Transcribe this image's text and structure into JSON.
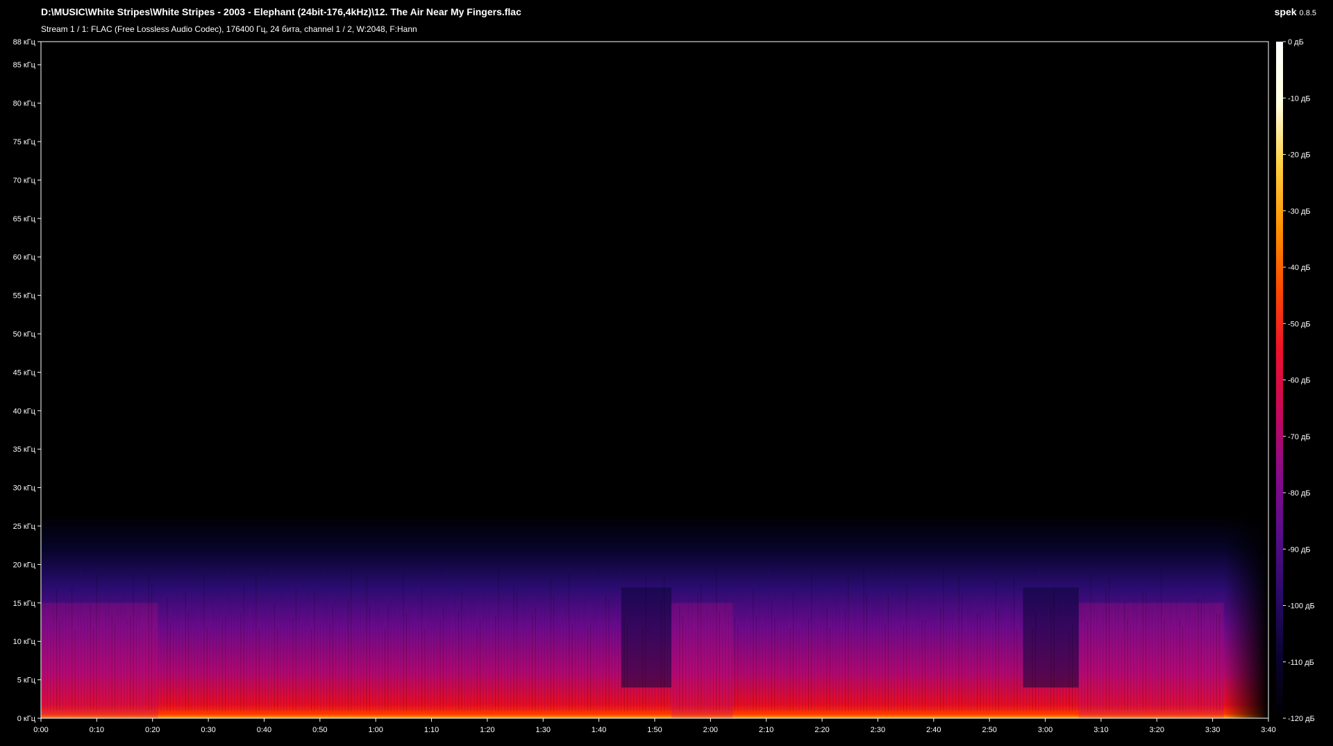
{
  "header": {
    "file_path": "D:\\MUSIC\\White Stripes\\White Stripes - 2003 - Elephant (24bit-176,4kHz)\\12. The Air Near My Fingers.flac",
    "stream_info": "Stream 1 / 1: FLAC (Free Lossless Audio Codec), 176400 Гц, 24 бита, channel 1 / 2, W:2048, F:Hann"
  },
  "app": {
    "name": "spek",
    "version": "0.8.5"
  },
  "frequency_axis": {
    "labels": [
      "0 кГц",
      "5 кГц",
      "10 кГц",
      "15 кГц",
      "20 кГц",
      "25 кГц",
      "30 кГц",
      "35 кГц",
      "40 кГц",
      "45 кГц",
      "50 кГц",
      "55 кГц",
      "60 кГц",
      "65 кГц",
      "70 кГц",
      "75 кГц",
      "80 кГц",
      "85 кГц",
      "88 кГц"
    ],
    "values_khz": [
      0,
      5,
      10,
      15,
      20,
      25,
      30,
      35,
      40,
      45,
      50,
      55,
      60,
      65,
      70,
      75,
      80,
      85,
      88
    ],
    "max_khz": 88
  },
  "time_axis": {
    "labels": [
      "0:00",
      "0:10",
      "0:20",
      "0:30",
      "0:40",
      "0:50",
      "1:00",
      "1:10",
      "1:20",
      "1:30",
      "1:40",
      "1:50",
      "2:00",
      "2:10",
      "2:20",
      "2:30",
      "2:40",
      "2:50",
      "3:00",
      "3:10",
      "3:20",
      "3:30",
      "3:40"
    ],
    "values_s": [
      0,
      10,
      20,
      30,
      40,
      50,
      60,
      70,
      80,
      90,
      100,
      110,
      120,
      130,
      140,
      150,
      160,
      170,
      180,
      190,
      200,
      210,
      220
    ],
    "max_s": 220
  },
  "level_scale": {
    "labels": [
      "0 дБ",
      "-10 дБ",
      "-20 дБ",
      "-30 дБ",
      "-40 дБ",
      "-50 дБ",
      "-60 дБ",
      "-70 дБ",
      "-80 дБ",
      "-90 дБ",
      "-100 дБ",
      "-110 дБ",
      "-120 дБ"
    ],
    "values_db": [
      0,
      -10,
      -20,
      -30,
      -40,
      -50,
      -60,
      -70,
      -80,
      -90,
      -100,
      -110,
      -120
    ],
    "colors": [
      "#000000",
      "#0a0330",
      "#2a0a6a",
      "#5a0c8a",
      "#8a0a8a",
      "#c8085a",
      "#f0102a",
      "#ff4a00",
      "#ff9400",
      "#ffd040",
      "#ffffe0",
      "#ffffff"
    ]
  },
  "spectrum": {
    "bandwidth_khz": 22,
    "cutoff_khz": 17,
    "loud_sections_s": [
      [
        0,
        21
      ],
      [
        113,
        124
      ],
      [
        186,
        212
      ]
    ],
    "quiet_gaps_s": [
      [
        104,
        113
      ],
      [
        176,
        186
      ]
    ],
    "fade_out_s": [
      212,
      220
    ]
  }
}
